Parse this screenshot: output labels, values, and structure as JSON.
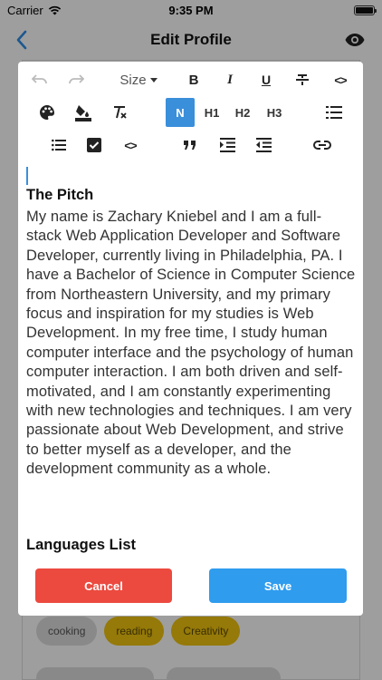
{
  "status_bar": {
    "carrier": "Carrier",
    "time": "9:35 PM"
  },
  "nav": {
    "title": "Edit Profile",
    "back_icon": "chevron-left-icon",
    "right_icon": "eye-icon",
    "accent": "#2f8ee8"
  },
  "background": {
    "tags": [
      "cooking",
      "reading",
      "Creativity"
    ]
  },
  "toolbar": {
    "size_label": "Size",
    "normal_label": "N",
    "h1_label": "H1",
    "h2_label": "H2",
    "h3_label": "H3",
    "bold_label": "B",
    "italic_label": "I",
    "underline_label": "U",
    "code_label": "<>",
    "active_color": "#3a8fdb"
  },
  "editor": {
    "heading": "The Pitch",
    "body": "My name is Zachary Kniebel and I am a full-stack Web Application Developer and Software Developer, currently living in Philadelphia, PA. I have a Bachelor of Science in Computer Science from Northeastern University, and my primary focus and inspiration for my studies is Web Development. In my free time, I study human computer interface and the psychology of human computer interaction. I am both driven and self-motivated, and I am constantly experimenting with new technologies and techniques. I am very passionate about Web Development, and strive to better myself as a developer, and the development community as a whole.",
    "next_heading": "Languages List"
  },
  "actions": {
    "cancel_label": "Cancel",
    "save_label": "Save",
    "cancel_color": "#ec4a3f",
    "save_color": "#2f9cee"
  }
}
